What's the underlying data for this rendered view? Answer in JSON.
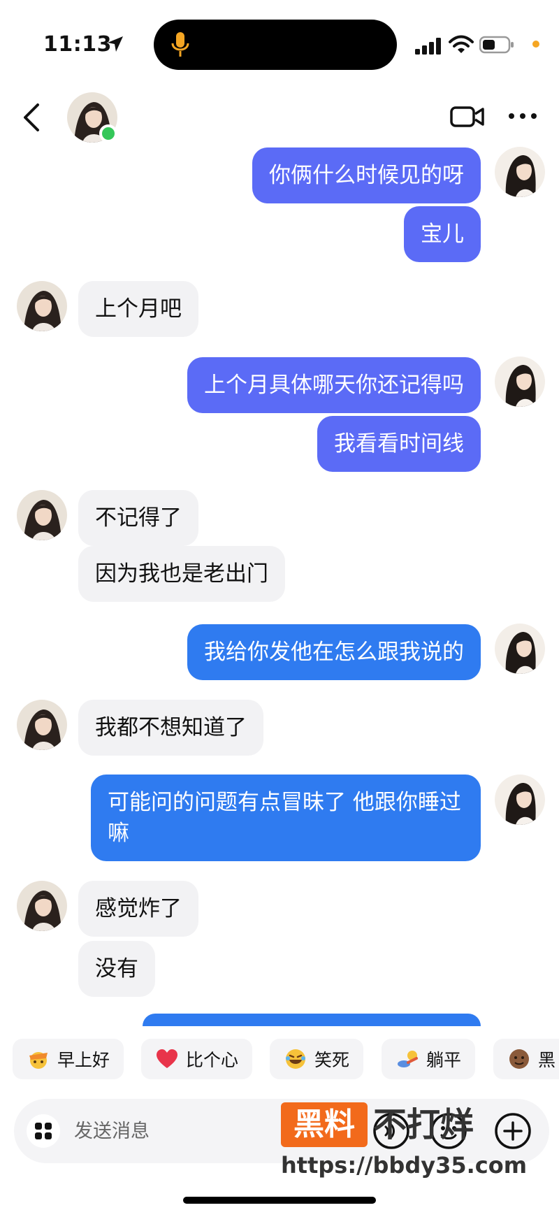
{
  "status_bar": {
    "time": "11:13",
    "icons": [
      "location-arrow-icon",
      "microphone-icon",
      "cellular-signal-icon",
      "wifi-icon",
      "battery-icon"
    ]
  },
  "header": {
    "icons": [
      "back-chevron-icon",
      "video-call-icon",
      "more-dots-icon"
    ],
    "online": true
  },
  "messages": [
    {
      "side": "out",
      "text": "你俩什么时候见的呀"
    },
    {
      "side": "out",
      "text": "宝儿"
    },
    {
      "side": "in",
      "text": "上个月吧"
    },
    {
      "side": "out",
      "text": "上个月具体哪天你还记得吗"
    },
    {
      "side": "out",
      "text": "我看看时间线"
    },
    {
      "side": "in",
      "text": "不记得了"
    },
    {
      "side": "in",
      "text": "因为我也是老出门"
    },
    {
      "side": "out",
      "text": "我给你发他在怎么跟我说的"
    },
    {
      "side": "in",
      "text": "我都不想知道了"
    },
    {
      "side": "out",
      "text": "可能问的问题有点冒昧了 他跟你睡过嘛"
    },
    {
      "side": "in",
      "text": "感觉炸了"
    },
    {
      "side": "in",
      "text": "没有"
    }
  ],
  "quick_replies": [
    {
      "label": "早上好",
      "icon": "morning-emoji-icon"
    },
    {
      "label": "比个心",
      "icon": "heart-icon"
    },
    {
      "label": "笑死",
      "icon": "laughing-emoji-icon"
    },
    {
      "label": "躺平",
      "icon": "lying-flat-emoji-icon"
    },
    {
      "label": "黑",
      "icon": "dark-emoji-icon"
    }
  ],
  "input": {
    "placeholder": "发送消息"
  },
  "watermark": {
    "badge": "黑料",
    "text": "不打烊",
    "url": "https://bbdy35.com"
  },
  "colors": {
    "outgoing_bubble": "#5b6bf6",
    "outgoing_bubble_alt": "#2f7bf0",
    "incoming_bubble": "#f2f2f4",
    "online_dot": "#34c759",
    "watermark_orange": "#f26a1b"
  }
}
